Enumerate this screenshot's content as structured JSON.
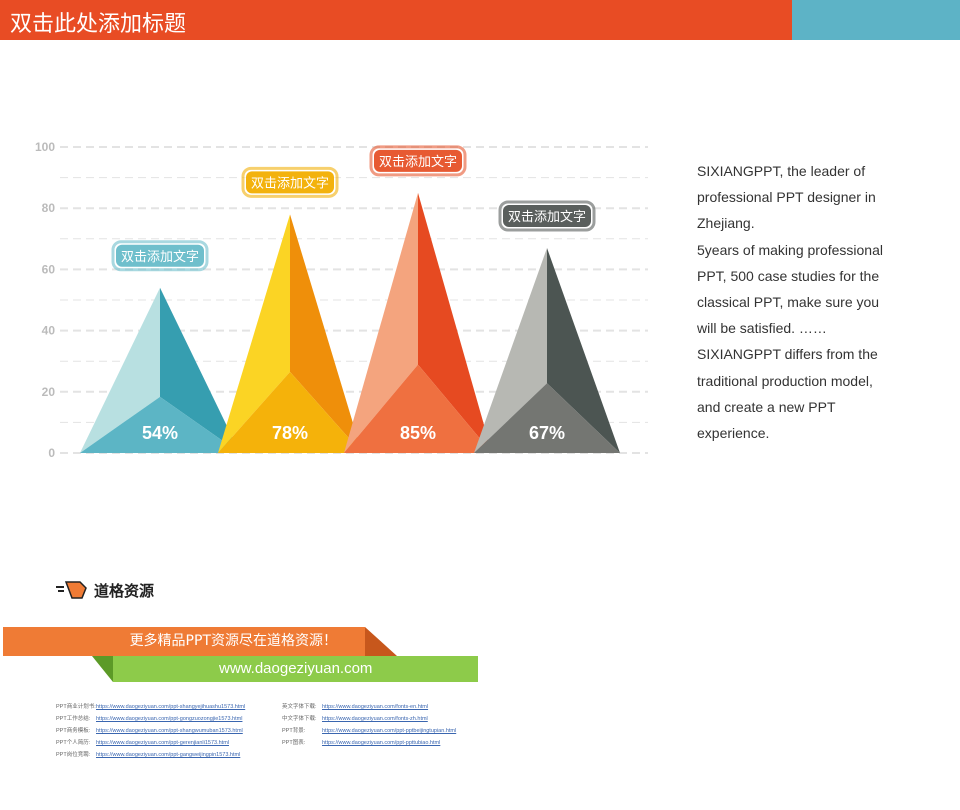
{
  "header": {
    "title": "双击此处添加标题",
    "colors": {
      "primary": "#e84c24",
      "secondary": "#5db3c6"
    }
  },
  "chart_data": {
    "type": "bar",
    "ylim": [
      0,
      100
    ],
    "yticks": [
      0,
      20,
      40,
      60,
      80,
      100
    ],
    "grid": true,
    "categories": [
      "54%",
      "78%",
      "85%",
      "67%"
    ],
    "values": [
      54,
      78,
      85,
      67
    ],
    "labels": [
      "双击添加文字",
      "双击添加文字",
      "双击添加文字",
      "双击添加文字"
    ],
    "colors": [
      {
        "light": "#b8e0e1",
        "dark": "#369eb0",
        "bottom": "#5cb5c5",
        "pill": "#6fbfcc"
      },
      {
        "light": "#fbd424",
        "dark": "#ef8f0a",
        "bottom": "#f5b20a",
        "pill": "#f3b20d"
      },
      {
        "light": "#f4a47e",
        "dark": "#e64a21",
        "bottom": "#ef7040",
        "pill": "#e75a32"
      },
      {
        "light": "#b7b8b3",
        "dark": "#4c5552",
        "bottom": "#747672",
        "pill": "#5a5f5d"
      }
    ]
  },
  "description": [
    "SIXIANGPPT,  the leader of professional PPT designer in Zhejiang.",
    "5years of making professional PPT, 500 case studies for the classical PPT, make sure you will be satisfied. ……SIXIANGPPT differs from the traditional production model, and create a new PPT experience."
  ],
  "footer": {
    "logo_text": "道格资源",
    "banner_text": "更多精品PPT资源尽在道格资源！",
    "site": "www.daogeziyuan.com",
    "links_left": [
      {
        "k": "PPT商业计划书:",
        "v": "https://www.daogeziyuan.com/ppt-shangyejihuashu1573.html"
      },
      {
        "k": "PPT工作总结:",
        "v": "https://www.daogeziyuan.com/ppt-gongzuozongjie1573.html"
      },
      {
        "k": "PPT商务模板:",
        "v": "https://www.daogeziyuan.com/ppt-shangwumuban1573.html"
      },
      {
        "k": "PPT个人简历:",
        "v": "https://www.daogeziyuan.com/ppt-gerenjianli1573.html"
      },
      {
        "k": "PPT岗位竞聘:",
        "v": "https://www.daogeziyuan.com/ppt-gangweijingpin1573.html"
      }
    ],
    "links_right": [
      {
        "k": "英文字体下载:",
        "v": "https://www.daogeziyuan.com/fonts-en.html"
      },
      {
        "k": "中文字体下载:",
        "v": "https://www.daogeziyuan.com/fonts-zh.html"
      },
      {
        "k": "PPT背景:",
        "v": "https://www.daogeziyuan.com/ppt-pptbeijingtupian.html"
      },
      {
        "k": "PPT图表:",
        "v": "https://www.daogeziyuan.com/ppt-ppttubiao.html"
      }
    ]
  }
}
